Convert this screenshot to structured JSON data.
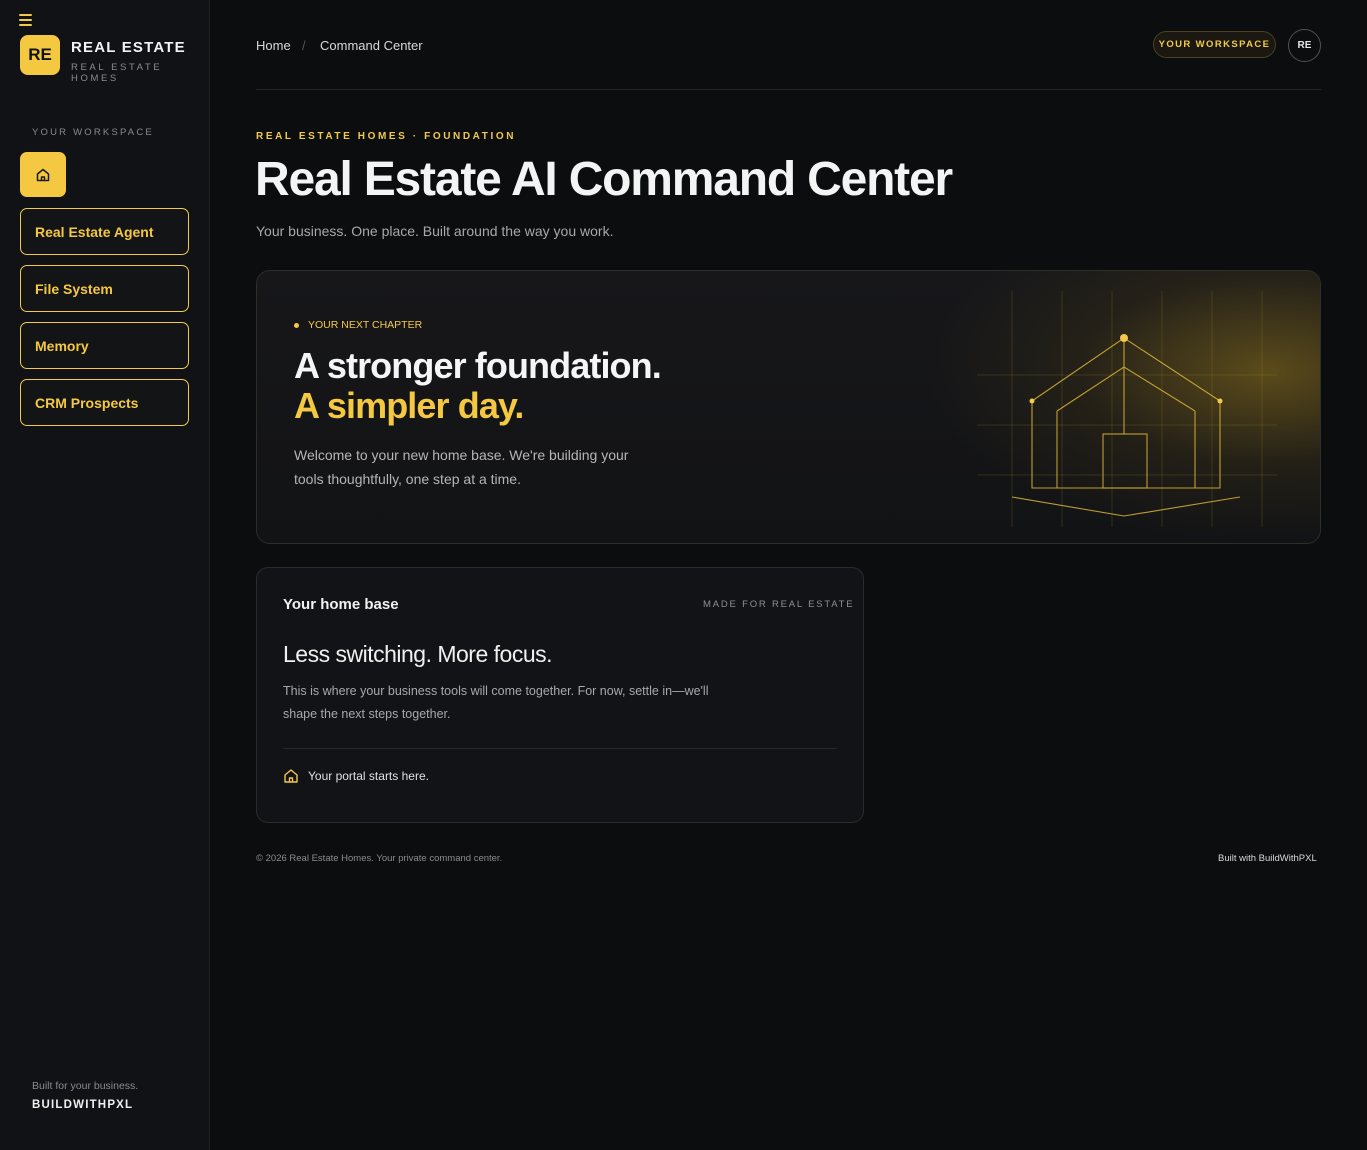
{
  "sidebar": {
    "logo_initials": "RE",
    "brand_title": "REAL ESTATE",
    "brand_subtitle": "REAL ESTATE HOMES",
    "section_label": "YOUR WORKSPACE",
    "nav_items": [
      {
        "label": "Real Estate Agent"
      },
      {
        "label": "File System"
      },
      {
        "label": "Memory"
      },
      {
        "label": "CRM Prospects"
      }
    ],
    "footer_line": "Built for your business.",
    "footer_brand": "BUILDWITHPXL"
  },
  "topbar": {
    "breadcrumb": [
      "Home",
      "Command Center"
    ],
    "separator": "/",
    "workspace_pill": "YOUR WORKSPACE",
    "avatar_initials": "RE"
  },
  "header": {
    "eyebrow": "REAL ESTATE HOMES · FOUNDATION",
    "title": "Real Estate AI Command Center",
    "subtitle": "Your business. One place. Built around the way you work."
  },
  "hero": {
    "tag": "YOUR NEXT CHAPTER",
    "headline_1": "A stronger foundation.",
    "headline_2": "A simpler day.",
    "body": "Welcome to your new home base. We're building your tools thoughtfully, one step at a time."
  },
  "home_base": {
    "title": "Your home base",
    "meta": "MADE FOR REAL ESTATE",
    "headline": "Less switching. More focus.",
    "body": "This is where your business tools will come together. For now, settle in—we'll shape the next steps together.",
    "footer": "Your portal starts here."
  },
  "footer": {
    "copyright": "© 2026 Real Estate Homes. Your private command center.",
    "built_with": "Built with BuildWithPXL"
  },
  "colors": {
    "accent": "#f5c842",
    "background": "#0c0d0f",
    "sidebar": "#111215"
  }
}
